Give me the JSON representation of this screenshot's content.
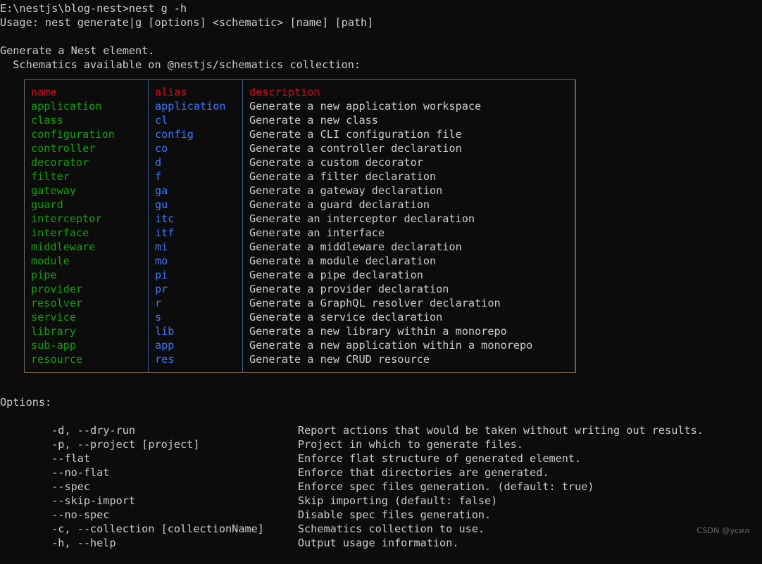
{
  "terminal": {
    "background_color": "#0c0c0c",
    "foreground_color": "#ccccc8",
    "prompt_line": "E:\\nestjs\\blog-nest>nest g -h",
    "usage_line": "Usage: nest generate|g [options] <schematic> [name] [path]",
    "description_line": "Generate a Nest element.",
    "schematics_line": "  Schematics available on @nestjs/schematics collection:"
  },
  "schematics_table": {
    "colors": {
      "header": "#c50f1f",
      "name": "#13a10e",
      "alias": "#3b78ff",
      "description": "#ccccc8",
      "outer_border": "#7b6a52",
      "column_divider": "#3a5a8c"
    },
    "headers": {
      "name": "name",
      "alias": "alias",
      "description": "description"
    },
    "rows": [
      {
        "name": "application",
        "alias": "application",
        "description": "Generate a new application workspace"
      },
      {
        "name": "class",
        "alias": "cl",
        "description": "Generate a new class"
      },
      {
        "name": "configuration",
        "alias": "config",
        "description": "Generate a CLI configuration file"
      },
      {
        "name": "controller",
        "alias": "co",
        "description": "Generate a controller declaration"
      },
      {
        "name": "decorator",
        "alias": "d",
        "description": "Generate a custom decorator"
      },
      {
        "name": "filter",
        "alias": "f",
        "description": "Generate a filter declaration"
      },
      {
        "name": "gateway",
        "alias": "ga",
        "description": "Generate a gateway declaration"
      },
      {
        "name": "guard",
        "alias": "gu",
        "description": "Generate a guard declaration"
      },
      {
        "name": "interceptor",
        "alias": "itc",
        "description": "Generate an interceptor declaration"
      },
      {
        "name": "interface",
        "alias": "itf",
        "description": "Generate an interface"
      },
      {
        "name": "middleware",
        "alias": "mi",
        "description": "Generate a middleware declaration"
      },
      {
        "name": "module",
        "alias": "mo",
        "description": "Generate a module declaration"
      },
      {
        "name": "pipe",
        "alias": "pi",
        "description": "Generate a pipe declaration"
      },
      {
        "name": "provider",
        "alias": "pr",
        "description": "Generate a provider declaration"
      },
      {
        "name": "resolver",
        "alias": "r",
        "description": "Generate a GraphQL resolver declaration"
      },
      {
        "name": "service",
        "alias": "s",
        "description": "Generate a service declaration"
      },
      {
        "name": "library",
        "alias": "lib",
        "description": "Generate a new library within a monorepo"
      },
      {
        "name": "sub-app",
        "alias": "app",
        "description": "Generate a new application within a monorepo"
      },
      {
        "name": "resource",
        "alias": "res",
        "description": "Generate a new CRUD resource"
      }
    ]
  },
  "options": {
    "title": "Options:",
    "items": [
      {
        "flag": "  -d, --dry-run",
        "description": "Report actions that would be taken without writing out results."
      },
      {
        "flag": "  -p, --project [project]",
        "description": "Project in which to generate files."
      },
      {
        "flag": "  --flat",
        "description": "Enforce flat structure of generated element."
      },
      {
        "flag": "  --no-flat",
        "description": "Enforce that directories are generated."
      },
      {
        "flag": "  --spec",
        "description": "Enforce spec files generation. (default: true)"
      },
      {
        "flag": "  --skip-import",
        "description": "Skip importing (default: false)"
      },
      {
        "flag": "  --no-spec",
        "description": "Disable spec files generation."
      },
      {
        "flag": "  -c, --collection [collectionName]",
        "description": "Schematics collection to use."
      },
      {
        "flag": "  -h, --help",
        "description": "Output usage information."
      }
    ]
  },
  "watermark": {
    "text": "CSDN @усил"
  }
}
